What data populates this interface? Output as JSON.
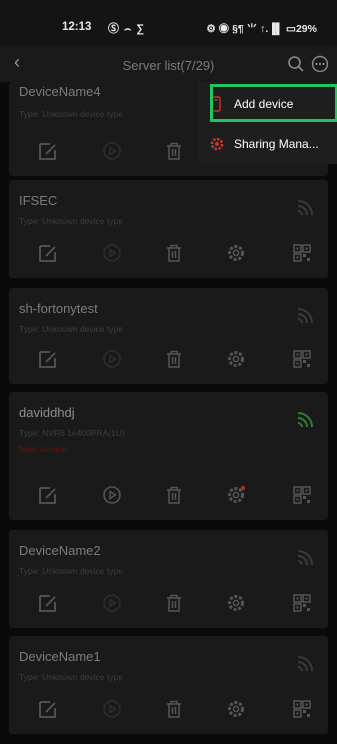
{
  "status_bar": {
    "time": "12:13",
    "left_icons": "Ⓢ ⌢ ∑",
    "right_icons": "⚙ ◉ §¶ ⺌ ↑.▐▌ ▭29%"
  },
  "nav": {
    "title": "Server list(7/29)"
  },
  "menu": {
    "items": [
      {
        "label": "Add device"
      },
      {
        "label": "Sharing Mana..."
      }
    ]
  },
  "devices": [
    {
      "name": "DeviceName4",
      "type": "Type: Unknown device type"
    },
    {
      "name": "IFSEC",
      "type": "Type: Unknown device type"
    },
    {
      "name": "sh-fortonytest",
      "type": "Type: Unknown device type"
    },
    {
      "name": "daviddhdj",
      "type": "Type: NVR8 1e400PRA(1U)",
      "new_version": "New Version"
    },
    {
      "name": "DeviceName2",
      "type": "Type: Unknown device type"
    },
    {
      "name": "DeviceName1",
      "type": "Type: Unknown device type"
    }
  ],
  "colors": {
    "accent_green": "#22c55e",
    "online_wifi": "#2e7d32",
    "offline_wifi": "#3a3a3a",
    "new_version": "#6b1212"
  }
}
